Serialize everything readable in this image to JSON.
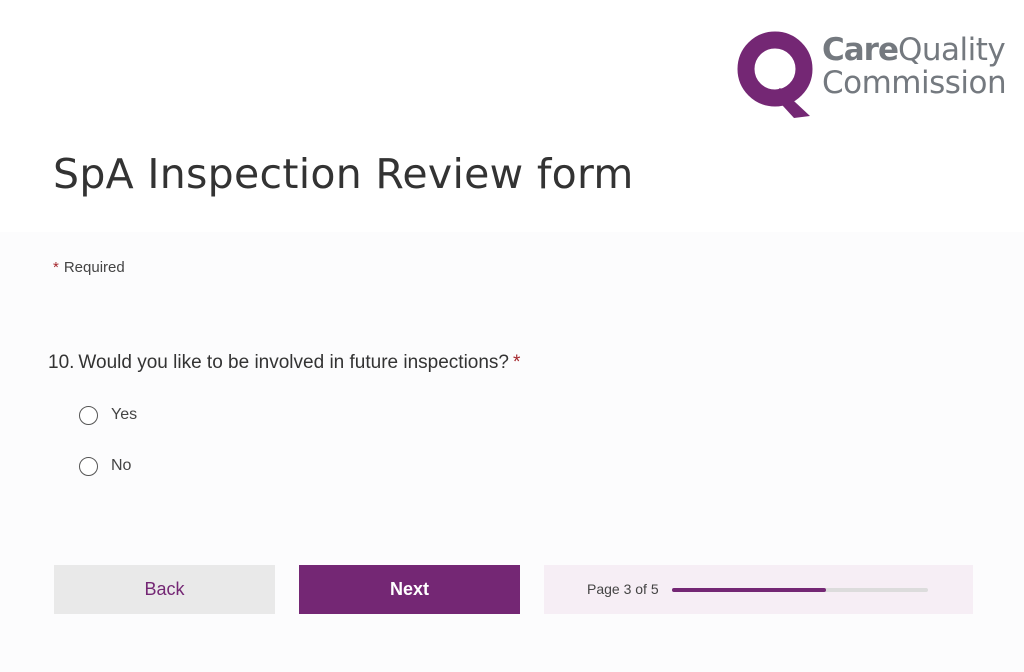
{
  "logo": {
    "line1_bold": "Care",
    "line1_rest": "Quality",
    "line2": "Commission"
  },
  "form": {
    "title": "SpA Inspection Review form",
    "required_star": "*",
    "required_label": "Required"
  },
  "question": {
    "number": "10.",
    "text": "Would you like to be involved in future inspections?",
    "required_star": "*",
    "options": [
      {
        "label": "Yes",
        "selected": false
      },
      {
        "label": "No",
        "selected": false
      }
    ]
  },
  "navigation": {
    "back_label": "Back",
    "next_label": "Next"
  },
  "progress": {
    "label": "Page 3 of 5",
    "current_page": 3,
    "total_pages": 5,
    "fill_fraction": 0.6
  },
  "colors": {
    "brand_purple": "#742774",
    "required_red": "#a4262c",
    "logo_grey": "#74797f"
  }
}
